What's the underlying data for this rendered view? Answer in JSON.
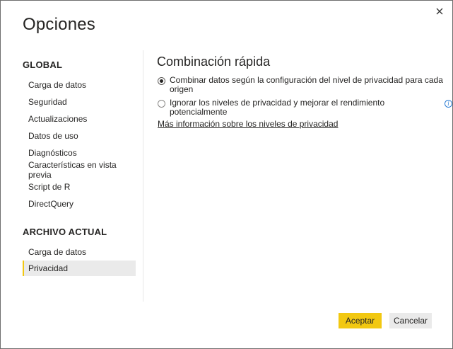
{
  "dialog": {
    "title": "Opciones",
    "close_label": "✕"
  },
  "sidebar": {
    "global_heading": "GLOBAL",
    "global_items": [
      {
        "label": "Carga de datos"
      },
      {
        "label": "Seguridad"
      },
      {
        "label": "Actualizaciones"
      },
      {
        "label": "Datos de uso"
      },
      {
        "label": "Diagnósticos"
      },
      {
        "label": "Características en vista previa"
      },
      {
        "label": "Script de R"
      },
      {
        "label": "DirectQuery"
      }
    ],
    "current_heading": "ARCHIVO ACTUAL",
    "current_items": [
      {
        "label": "Carga de datos"
      },
      {
        "label": "Privacidad",
        "selected": true
      }
    ]
  },
  "content": {
    "title": "Combinación rápida",
    "options": [
      {
        "label": "Combinar datos según la configuración del nivel de privacidad para cada",
        "label_line2": "origen",
        "checked": true
      },
      {
        "label": "Ignorar los niveles de privacidad y mejorar el rendimiento potencialmente",
        "checked": false,
        "info": "i"
      }
    ],
    "link": "Más información sobre los niveles de privacidad"
  },
  "footer": {
    "accept_label": "Aceptar",
    "cancel_label": "Cancelar"
  },
  "colors": {
    "accent": "#f2c811",
    "selected_bg": "#eaeaea",
    "info_blue": "#2b7cd3"
  }
}
